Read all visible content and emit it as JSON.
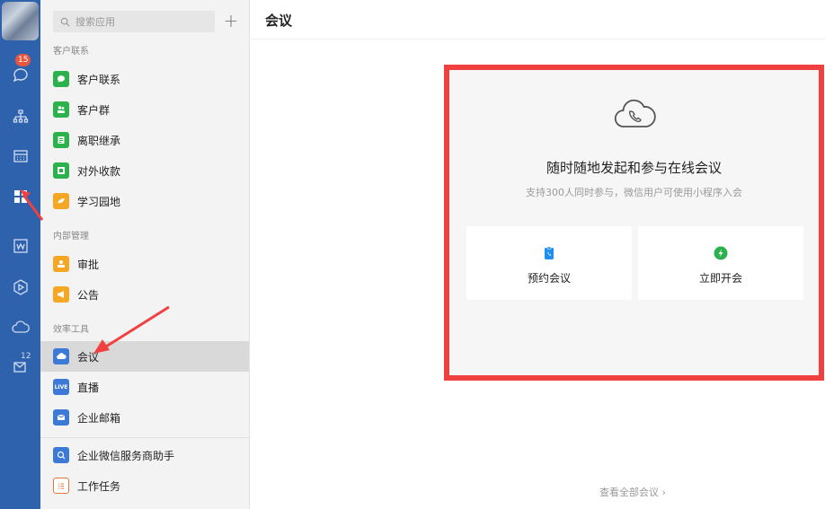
{
  "rail": {
    "chat_badge": "15",
    "mail_count": "12"
  },
  "sidebar": {
    "search_placeholder": "搜索应用",
    "groups": [
      {
        "label": "客户联系",
        "items": [
          {
            "label": "客户联系",
            "color": "#2bb24c"
          },
          {
            "label": "客户群",
            "color": "#2bb24c"
          },
          {
            "label": "离职继承",
            "color": "#2bb24c"
          },
          {
            "label": "对外收款",
            "color": "#2bb24c"
          },
          {
            "label": "学习园地",
            "color": "#f5a623"
          }
        ]
      },
      {
        "label": "内部管理",
        "items": [
          {
            "label": "审批",
            "color": "#f5a623"
          },
          {
            "label": "公告",
            "color": "#f5a623"
          }
        ]
      },
      {
        "label": "效率工具",
        "items": [
          {
            "label": "会议",
            "color": "#3d7ad8"
          },
          {
            "label": "直播",
            "color": "#3d7ad8"
          },
          {
            "label": "企业邮箱",
            "color": "#3d7ad8"
          }
        ]
      }
    ],
    "extra_items": [
      {
        "label": "企业微信服务商助手",
        "color": "#3d7ad8"
      },
      {
        "label": "工作任务",
        "color": "#e8763f"
      }
    ],
    "live_text": "LIVE"
  },
  "main": {
    "title": "会议",
    "headline": "随时随地发起和参与在线会议",
    "subline": "支持300人同时参与，微信用户可使用小程序入会",
    "actions": [
      {
        "label": "预约会议",
        "color": "#1f8ef1"
      },
      {
        "label": "立即开会",
        "color": "#2bb24c"
      }
    ],
    "footer_link": "查看全部会议 ›"
  },
  "colors": {
    "rail_bg": "#2f62ad",
    "highlight": "#f04040"
  }
}
